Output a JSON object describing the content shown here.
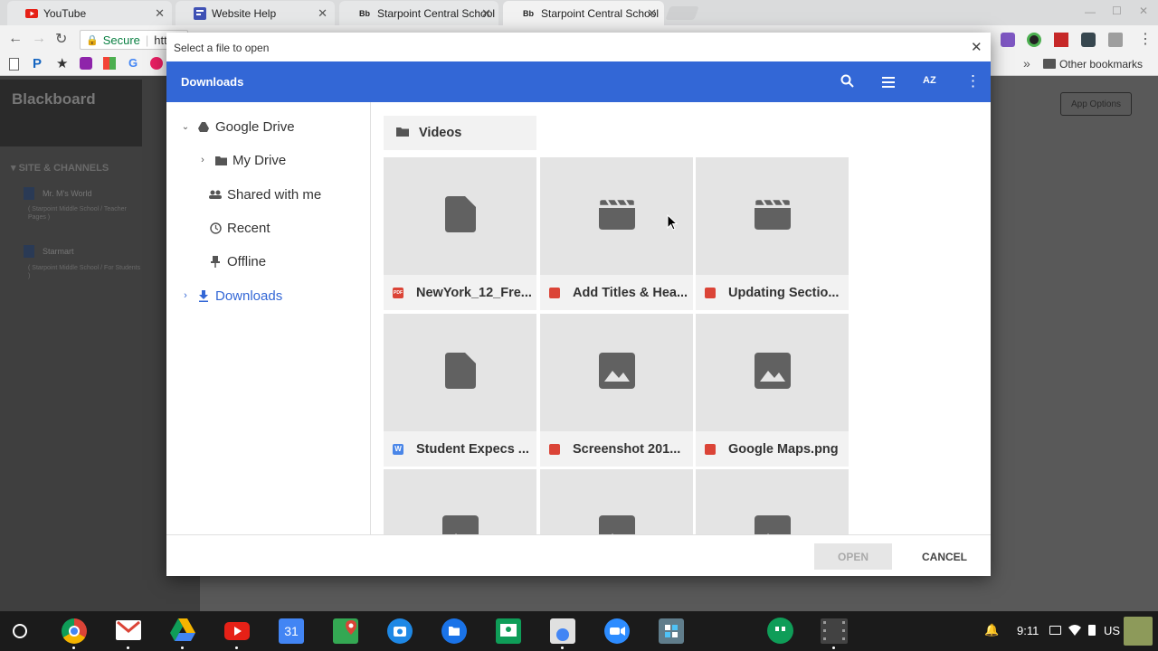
{
  "browser": {
    "tabs": [
      {
        "label": "YouTube",
        "favicon": "youtube-icon"
      },
      {
        "label": "Website Help",
        "favicon": "forms-icon"
      },
      {
        "label": "Starpoint Central School",
        "favicon": "blackboard-icon"
      },
      {
        "label": "Starpoint Central School",
        "favicon": "blackboard-icon"
      }
    ],
    "secure_label": "Secure",
    "url_fragment": "htt",
    "other_bookmarks": "Other bookmarks",
    "more_bookmarks": "»",
    "bb_favicon_text": "Bb"
  },
  "page": {
    "brand": "Blackboard",
    "section": "SITE & CHANNELS",
    "items": [
      {
        "title": "Mr. M's World",
        "sub": "( Starpoint Middle School / Teacher Pages )"
      },
      {
        "title": "Starmart",
        "sub": "( Starpoint Middle School / For Students )"
      }
    ],
    "app_options": "App Options"
  },
  "dialog": {
    "title": "Select a file to open",
    "location": "Downloads",
    "sidebar": [
      {
        "label": "Google Drive",
        "icon": "google-drive-icon"
      },
      {
        "label": "My Drive",
        "icon": "my-drive-icon"
      },
      {
        "label": "Shared with me",
        "icon": "people-icon"
      },
      {
        "label": "Recent",
        "icon": "clock-icon"
      },
      {
        "label": "Offline",
        "icon": "pin-icon"
      },
      {
        "label": "Downloads",
        "icon": "download-icon"
      }
    ],
    "folder": "Videos",
    "files": [
      {
        "name": "NewYork_12_Fre...",
        "type": "pdf",
        "thumb": "file-icon",
        "badge": "PDF"
      },
      {
        "name": "Add Titles & Hea...",
        "type": "video",
        "thumb": "video-icon"
      },
      {
        "name": "Updating Sectio...",
        "type": "video",
        "thumb": "video-icon"
      },
      {
        "name": "Student Expecs ...",
        "type": "word",
        "thumb": "file-icon",
        "badge": "W"
      },
      {
        "name": "Screenshot 201...",
        "type": "image",
        "thumb": "image-icon"
      },
      {
        "name": "Google Maps.png",
        "type": "image",
        "thumb": "image-icon"
      }
    ],
    "open_label": "OPEN",
    "cancel_label": "CANCEL"
  },
  "shelf": {
    "calendar_day": "31",
    "time": "9:11",
    "locale": "US"
  },
  "colors": {
    "accent": "#3367d6",
    "pdf": "#db4437",
    "word": "#4a86e8"
  }
}
